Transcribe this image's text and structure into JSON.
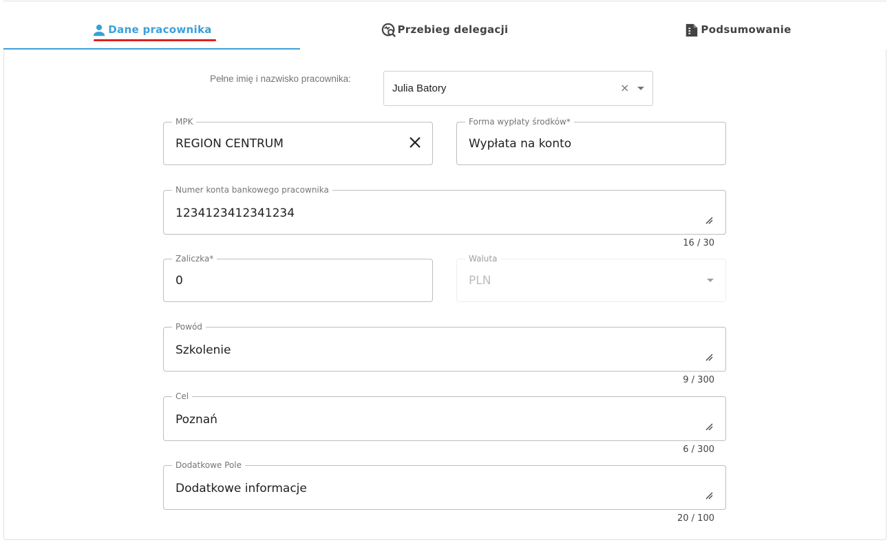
{
  "tabs": [
    {
      "label": "Dane pracownika",
      "icon": "person-icon",
      "active": true
    },
    {
      "label": "Przebieg delegacji",
      "icon": "route-search-icon",
      "active": false
    },
    {
      "label": "Podsumowanie",
      "icon": "summary-document-icon",
      "active": false
    }
  ],
  "colors": {
    "accent": "#3aa0d8",
    "highlight": "#e0201c"
  },
  "employee": {
    "label": "Pełne imię i nazwisko pracownika:",
    "value": "Julia Batory",
    "clear": "×"
  },
  "fields": {
    "mpk": {
      "label": "MPK",
      "value": "REGION CENTRUM"
    },
    "payout": {
      "label": "Forma wypłaty środków*",
      "value": "Wypłata na konto"
    },
    "account": {
      "label": "Numer konta bankowego pracownika",
      "value": "1234123412341234",
      "counter": "16 / 30"
    },
    "advance": {
      "label": "Zaliczka*",
      "value": "0"
    },
    "currency": {
      "label": "Waluta",
      "value": "PLN"
    },
    "reason": {
      "label": "Powód",
      "value": "Szkolenie",
      "counter": "9 / 300"
    },
    "goal": {
      "label": "Cel",
      "value": "Poznań",
      "counter": "6 / 300"
    },
    "extra": {
      "label": "Dodatkowe Pole",
      "value": "Dodatkowe informacje",
      "counter": "20 / 100"
    }
  }
}
